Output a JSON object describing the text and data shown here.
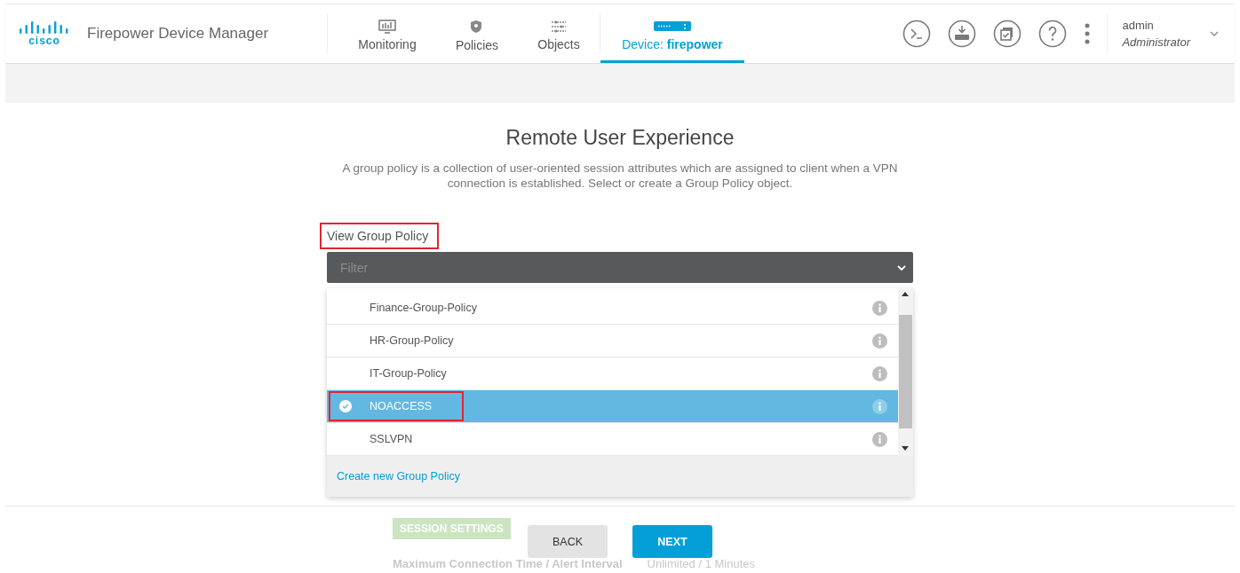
{
  "header": {
    "logo_text": "cisco",
    "app_title": "Firepower Device Manager",
    "nav": [
      {
        "kind": "monitoring",
        "label": "Monitoring",
        "selected": false
      },
      {
        "kind": "policies",
        "label": "Policies",
        "selected": false
      },
      {
        "kind": "objects",
        "label": "Objects",
        "selected": false
      },
      {
        "kind": "device",
        "label": "Device: **firepower**",
        "selected": true
      }
    ],
    "actions": [
      {
        "kind": "terminal"
      },
      {
        "kind": "deploy"
      },
      {
        "kind": "tasks"
      },
      {
        "kind": "help"
      },
      {
        "kind": "more"
      }
    ],
    "user": {
      "name": "admin",
      "role": "Administrator"
    }
  },
  "page": {
    "title": "Remote User Experience",
    "description": "A group policy is a collection of user-oriented session attributes which are assigned to client when a VPN connection is established. Select or create a Group Policy object.",
    "field_label": "View Group Policy",
    "field_label_highlighted": true,
    "dropdown": {
      "placeholder": "Filter",
      "items": [
        {
          "label": "Finance-Group-Policy",
          "selected": false,
          "highlighted": false
        },
        {
          "label": "HR-Group-Policy",
          "selected": false,
          "highlighted": false
        },
        {
          "label": "IT-Group-Policy",
          "selected": false,
          "highlighted": false
        },
        {
          "label": "NOACCESS",
          "selected": true,
          "highlighted": true
        },
        {
          "label": "SSLVPN",
          "selected": false,
          "highlighted": false
        }
      ],
      "create_link": "Create new Group Policy"
    },
    "behind": {
      "section": "SESSION SETTINGS",
      "row_label": "Maximum Connection Time / Alert Interval",
      "row_value": "Unlimited / 1 Minutes"
    }
  },
  "footer": {
    "buttons": [
      {
        "kind": "secondary",
        "label": "BACK"
      },
      {
        "kind": "primary",
        "label": "NEXT"
      }
    ]
  }
}
